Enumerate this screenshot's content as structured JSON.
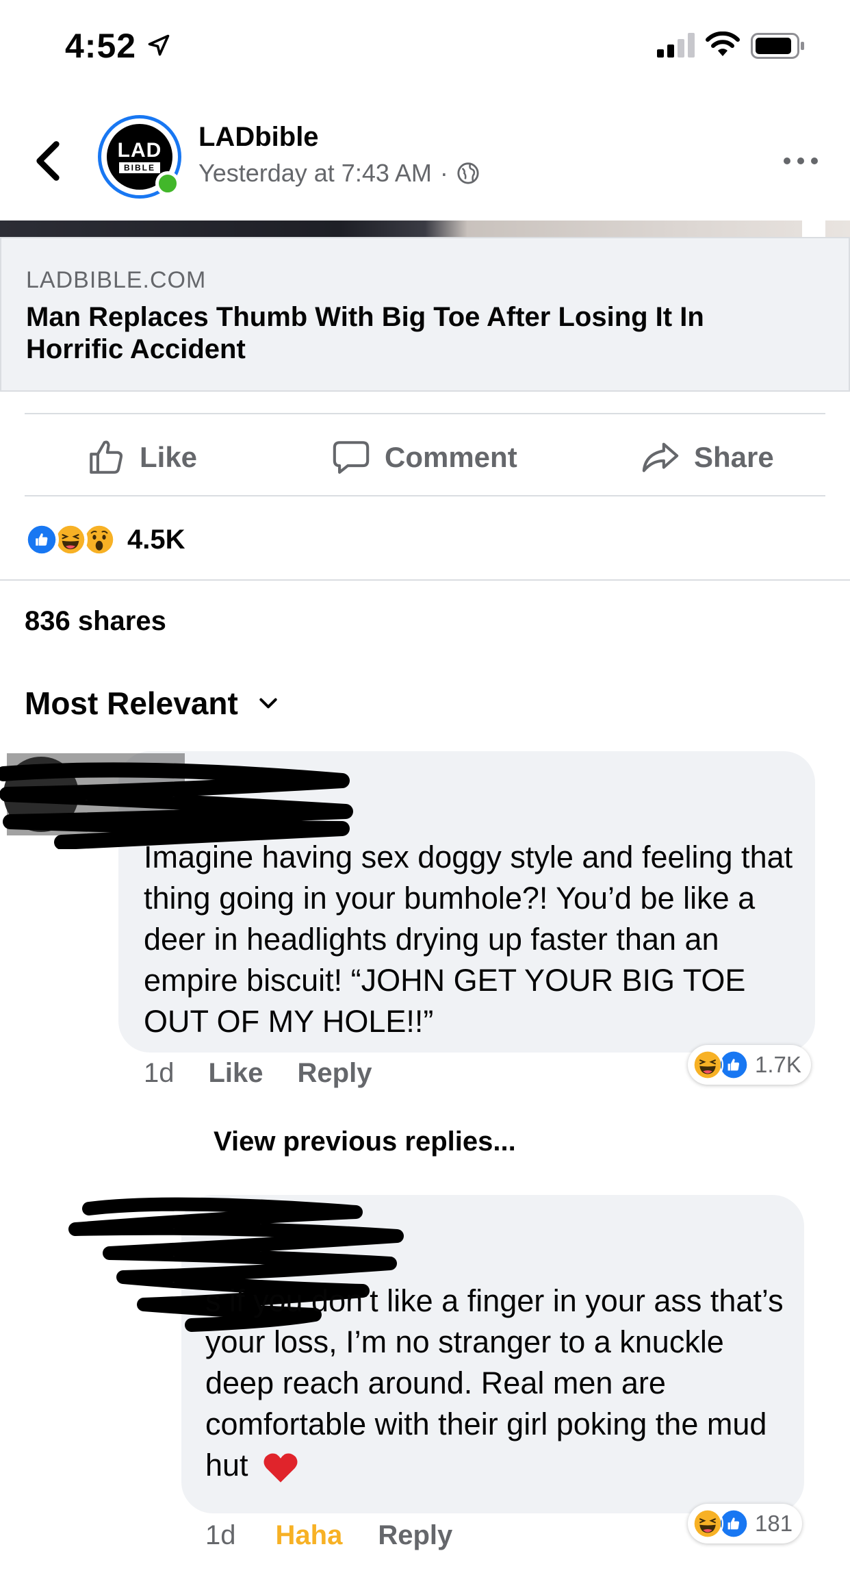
{
  "status_bar": {
    "time": "4:52"
  },
  "header": {
    "page_name": "LADbible",
    "post_time": "Yesterday at 7:43 AM",
    "separator": "·"
  },
  "link_card": {
    "domain": "LADBIBLE.COM",
    "title": "Man Replaces Thumb With Big Toe After Losing It In Horrific Accident"
  },
  "actions": {
    "like": "Like",
    "comment": "Comment",
    "share": "Share"
  },
  "reactions": {
    "count": "4.5K"
  },
  "shares": "836 shares",
  "sort": {
    "label": "Most Relevant"
  },
  "comments": [
    {
      "text": "Imagine having sex doggy style and feeling that thing going in your bumhole?! You’d be like a deer in headlights drying up faster than an empire biscuit! “JOHN GET YOUR BIG TOE OUT OF MY HOLE!!”",
      "time": "1d",
      "like_label": "Like",
      "reply_label": "Reply",
      "reaction_count": "1.7K"
    },
    {
      "text": "s if you don’t like a finger in your ass that’s your loss, I’m no stranger to a knuckle deep reach around. Real men are comfortable with their girl poking the mud hut",
      "time": "1d",
      "like_label": "Haha",
      "reply_label": "Reply",
      "reaction_count": "181"
    }
  ],
  "view_previous": "View previous replies...",
  "colors": {
    "accent": "#1877f2",
    "haha": "#f7b125",
    "secondary_text": "#65676b",
    "bubble": "#f0f2f5"
  }
}
